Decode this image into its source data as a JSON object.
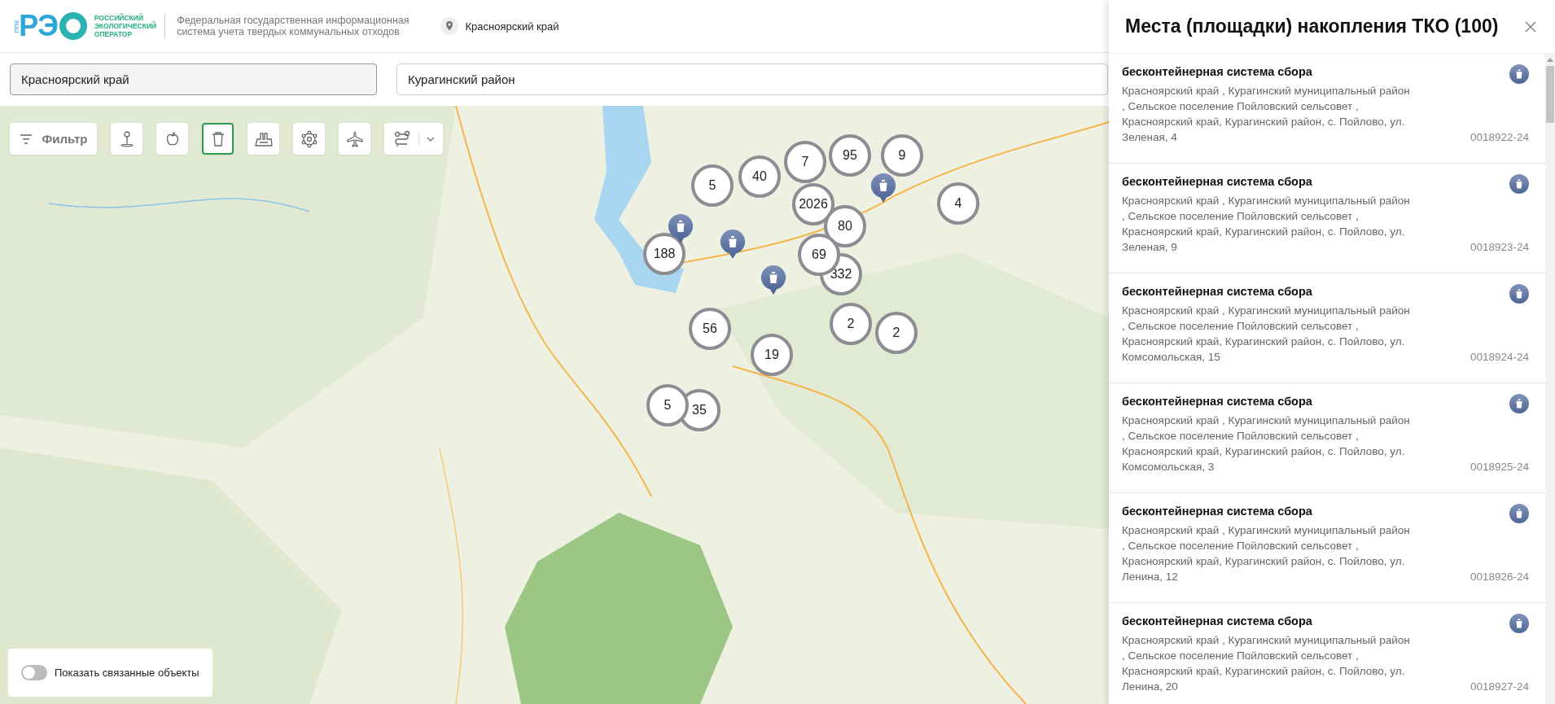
{
  "header": {
    "logo": {
      "prefix": "ППК",
      "mark": "РЭ",
      "name_lines": [
        "РОССИЙСКИЙ",
        "ЭКОЛОГИЧЕСКИЙ",
        "ОПЕРАТОР"
      ]
    },
    "system_title_lines": [
      "Федеральная государственная информационная",
      "система учета твердых коммунальных отходов"
    ],
    "region": "Красноярский край"
  },
  "filters": [
    {
      "value": "Красноярский край",
      "disabled": true
    },
    {
      "value": "Курагинский район",
      "disabled": false
    }
  ],
  "toolbar": {
    "filter_label": "Фильтр",
    "layers": [
      {
        "kind": "pin",
        "selected": false
      },
      {
        "kind": "apple",
        "selected": false
      },
      {
        "kind": "bin",
        "selected": true
      },
      {
        "kind": "factory",
        "selected": false
      },
      {
        "kind": "ring",
        "selected": false
      },
      {
        "kind": "plane",
        "selected": false
      },
      {
        "kind": "route",
        "selected": false,
        "dropdown": true
      }
    ]
  },
  "map": {
    "clusters": [
      {
        "count": "40"
      },
      {
        "count": "7"
      },
      {
        "count": "95"
      },
      {
        "count": "9"
      },
      {
        "count": "2026"
      },
      {
        "count": "5"
      },
      {
        "count": "80"
      },
      {
        "count": "4"
      },
      {
        "count": "188"
      },
      {
        "count": "332"
      },
      {
        "count": "69"
      },
      {
        "count": "2"
      },
      {
        "count": "2"
      },
      {
        "count": "56"
      },
      {
        "count": "19"
      },
      {
        "count": "35"
      },
      {
        "count": "5"
      }
    ]
  },
  "related_toggle": {
    "label": "Показать связанные объекты",
    "on": false
  },
  "panel": {
    "title": "Места (площадки) накопления ТКО (100)",
    "items": [
      {
        "title": "бесконтейнерная система сбора",
        "address_lines": [
          "Красноярский край , Курагинский муниципальный район",
          ", Сельское поселение Пойловский сельсовет ,",
          "Красноярский край, Курагинский район, с. Пойлово, ул.",
          "Зеленая, 4"
        ],
        "code": "0018922-24"
      },
      {
        "title": "бесконтейнерная система сбора",
        "address_lines": [
          "Красноярский край , Курагинский муниципальный район",
          ", Сельское поселение Пойловский сельсовет ,",
          "Красноярский край, Курагинский район, с. Пойлово, ул.",
          "Зеленая, 9"
        ],
        "code": "0018923-24"
      },
      {
        "title": "бесконтейнерная система сбора",
        "address_lines": [
          "Красноярский край , Курагинский муниципальный район",
          ", Сельское поселение Пойловский сельсовет ,",
          "Красноярский край, Курагинский район, с. Пойлово, ул.",
          "Комсомольская, 15"
        ],
        "code": "0018924-24"
      },
      {
        "title": "бесконтейнерная система сбора",
        "address_lines": [
          "Красноярский край , Курагинский муниципальный район",
          ", Сельское поселение Пойловский сельсовет ,",
          "Красноярский край, Курагинский район, с. Пойлово, ул.",
          "Комсомольская, 3"
        ],
        "code": "0018925-24"
      },
      {
        "title": "бесконтейнерная система сбора",
        "address_lines": [
          "Красноярский край , Курагинский муниципальный район",
          ", Сельское поселение Пойловский сельсовет ,",
          "Красноярский край, Курагинский район, с. Пойлово, ул.",
          "Ленина, 12"
        ],
        "code": "0018926-24"
      },
      {
        "title": "бесконтейнерная система сбора",
        "address_lines": [
          "Красноярский край , Курагинский муниципальный район",
          ", Сельское поселение Пойловский сельсовет ,",
          "Красноярский край, Курагинский район, с. Пойлово, ул.",
          "Ленина, 20"
        ],
        "code": "0018927-24"
      }
    ]
  }
}
